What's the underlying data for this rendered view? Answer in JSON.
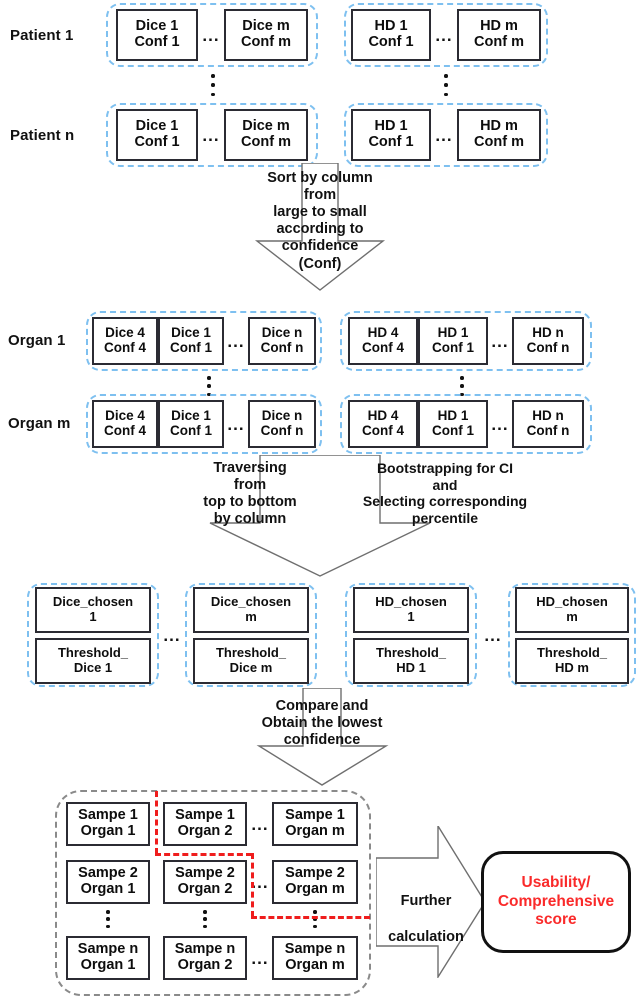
{
  "figure": {
    "title": "Conformal prediction pipeline for Dice/HD usability scoring"
  },
  "stage1": {
    "row_labels": [
      "Patient 1",
      "Patient n"
    ],
    "groups": [
      {
        "name": "dice-group-patient-1",
        "cells": [
          {
            "l1": "Dice 1",
            "l2": "Conf 1"
          },
          {
            "l1": "Dice m",
            "l2": "Conf m"
          }
        ],
        "ellipsis": "..."
      },
      {
        "name": "hd-group-patient-1",
        "cells": [
          {
            "l1": "HD  1",
            "l2": "Conf 1"
          },
          {
            "l1": "HD  m",
            "l2": "Conf m"
          }
        ],
        "ellipsis": "..."
      },
      {
        "name": "dice-group-patient-n",
        "cells": [
          {
            "l1": "Dice 1",
            "l2": "Conf 1"
          },
          {
            "l1": "Dice m",
            "l2": "Conf m"
          }
        ],
        "ellipsis": "..."
      },
      {
        "name": "hd-group-patient-n",
        "cells": [
          {
            "l1": "HD  1",
            "l2": "Conf 1"
          },
          {
            "l1": "HD  m",
            "l2": "Conf m"
          }
        ],
        "ellipsis": "..."
      }
    ]
  },
  "arrow1": {
    "lines": [
      "Sort by column",
      "from",
      "large to small",
      "according to",
      "confidence",
      "(Conf)"
    ],
    "text": "Sort by column\nfrom\nlarge to small\naccording to\nconfidence\n(Conf)"
  },
  "stage2": {
    "row_labels": [
      "Organ 1",
      "Organ m"
    ],
    "groups": [
      {
        "name": "dice-group-organ-1",
        "cells": [
          {
            "l1": "Dice 4",
            "l2": "Conf 4"
          },
          {
            "l1": "Dice 1",
            "l2": "Conf 1"
          },
          {
            "l1": "Dice n",
            "l2": "Conf n"
          }
        ],
        "ellipsis": "..."
      },
      {
        "name": "hd-group-organ-1",
        "cells": [
          {
            "l1": "HD  4",
            "l2": "Conf 4"
          },
          {
            "l1": "HD  1",
            "l2": "Conf 1"
          },
          {
            "l1": "HD  n",
            "l2": "Conf n"
          }
        ],
        "ellipsis": "..."
      },
      {
        "name": "dice-group-organ-m",
        "cells": [
          {
            "l1": "Dice 4",
            "l2": "Conf 4"
          },
          {
            "l1": "Dice 1",
            "l2": "Conf 1"
          },
          {
            "l1": "Dice n",
            "l2": "Conf n"
          }
        ],
        "ellipsis": "..."
      },
      {
        "name": "hd-group-organ-m",
        "cells": [
          {
            "l1": "HD  4",
            "l2": "Conf 4"
          },
          {
            "l1": "HD  1",
            "l2": "Conf 1"
          },
          {
            "l1": "HD  n",
            "l2": "Conf n"
          }
        ],
        "ellipsis": "..."
      }
    ]
  },
  "arrow2": {
    "left_text": "Traversing\nfrom\ntop to bottom\nby column",
    "right_text": "Bootstrapping for CI\nand\nSelecting corresponding\npercentile"
  },
  "stage3": {
    "groups": [
      {
        "name": "dice-chosen-1",
        "top": {
          "l1": "Dice_chosen",
          "l2": "1"
        },
        "bottom": {
          "l1": "Threshold_",
          "l2": "Dice 1"
        }
      },
      {
        "name": "dice-chosen-m",
        "top": {
          "l1": "Dice_chosen",
          "l2": "m"
        },
        "bottom": {
          "l1": "Threshold_",
          "l2": "Dice m"
        }
      },
      {
        "name": "hd-chosen-1",
        "top": {
          "l1": "HD_chosen",
          "l2": "1"
        },
        "bottom": {
          "l1": "Threshold_",
          "l2": "HD 1"
        }
      },
      {
        "name": "hd-chosen-m",
        "top": {
          "l1": "HD_chosen",
          "l2": "m"
        },
        "bottom": {
          "l1": "Threshold_",
          "l2": "HD m"
        }
      }
    ],
    "ellipsis_dice": "...",
    "ellipsis_hd": "..."
  },
  "arrow3": {
    "text": "Compare and\nObtain the lowest\nconfidence"
  },
  "stage4": {
    "grid": [
      [
        {
          "l1": "Sampe 1",
          "l2": "Organ 1"
        },
        {
          "l1": "Sampe 1",
          "l2": "Organ 2"
        },
        {
          "l1": "Sampe 1",
          "l2": "Organ m"
        }
      ],
      [
        {
          "l1": "Sampe 2",
          "l2": "Organ 1"
        },
        {
          "l1": "Sampe 2",
          "l2": "Organ 2"
        },
        {
          "l1": "Sampe 2",
          "l2": "Organ m"
        }
      ],
      [
        {
          "l1": "Sampe n",
          "l2": "Organ 1"
        },
        {
          "l1": "Sampe n",
          "l2": "Organ 2"
        },
        {
          "l1": "Sampe n",
          "l2": "Organ m"
        }
      ]
    ],
    "row_ellipsis": [
      "...",
      "...",
      "..."
    ]
  },
  "arrow4": {
    "text": "Further\ncalculation",
    "line1": "Further",
    "line2": "calculation"
  },
  "result": {
    "text": "Usability/\nComprehensive\nscore",
    "line1": "Usability/",
    "line2": "Comprehensive",
    "line3": "score"
  },
  "colors": {
    "blue_dash": "#7ec0f0",
    "gray_dash": "#8a8a8a",
    "red_dash": "#ef1d1d",
    "result_text": "#fa2a2a",
    "box_border": "#2b2b33",
    "arrow_stroke": "#6f6f6f"
  }
}
